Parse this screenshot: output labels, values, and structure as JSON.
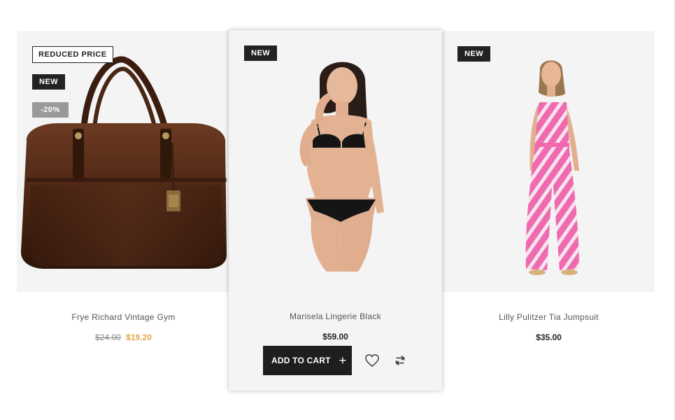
{
  "products": [
    {
      "title": "Frye Richard Vintage Gym",
      "badges": {
        "reduced": "REDUCED PRICE",
        "new": "NEW",
        "discount": "-20%"
      },
      "old_price": "$24.00",
      "price": "$19.20",
      "image": "brown-leather-bag"
    },
    {
      "title": "Marisela Lingerie Black",
      "badges": {
        "new": "NEW"
      },
      "price": "$59.00",
      "image": "model-lingerie",
      "add_to_cart_label": "ADD TO CART",
      "add_to_cart_icon": "+"
    },
    {
      "title": "Lilly Pulitzer Tia Jumpsuit",
      "badges": {
        "new": "NEW"
      },
      "price": "$35.00",
      "image": "model-pink-jumpsuit"
    }
  ],
  "colors": {
    "sale": "#e7a44a",
    "badge_dark": "#222222",
    "badge_gray": "#999999",
    "card_bg": "#f4f4f4"
  }
}
